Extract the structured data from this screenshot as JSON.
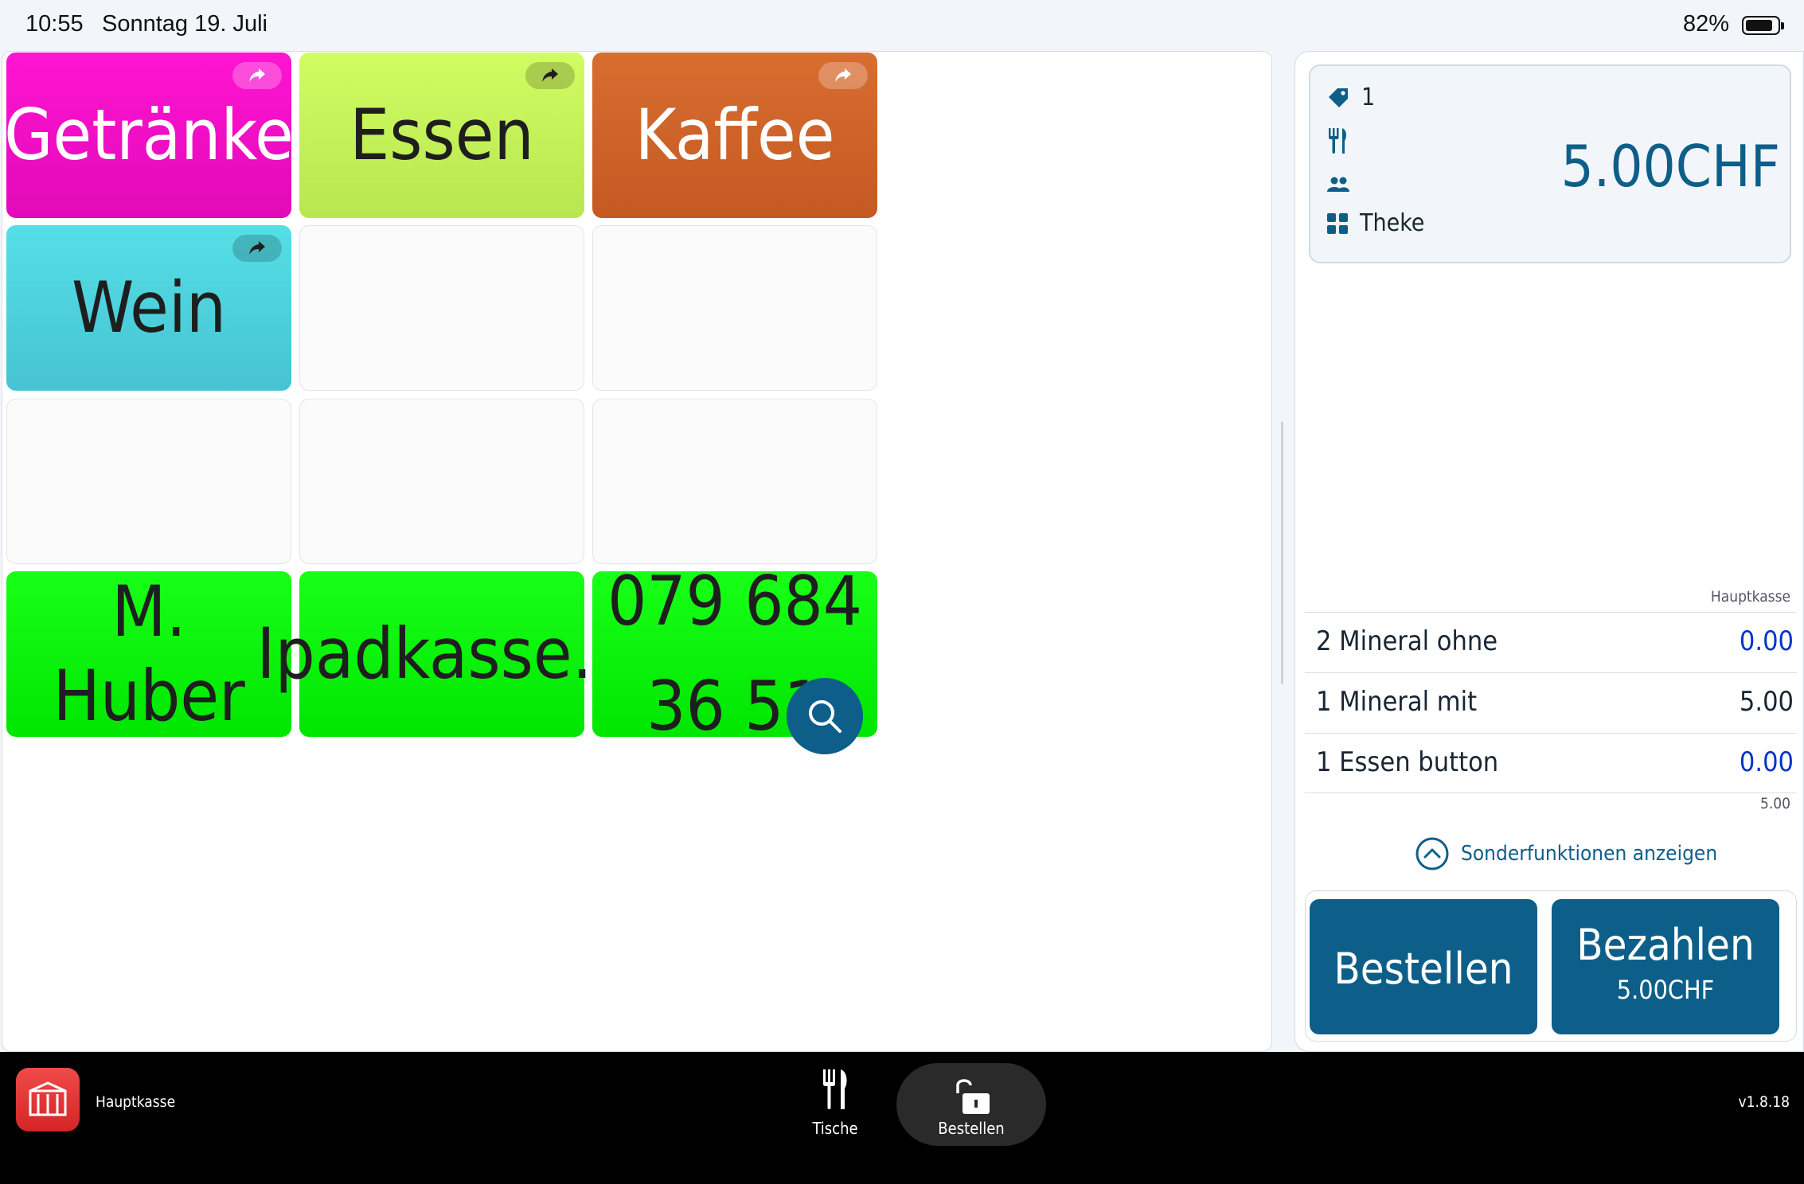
{
  "status_bar": {
    "time": "10:55",
    "date": "Sonntag 19. Juli",
    "battery_percent": "82%",
    "battery_level": 0.82
  },
  "grid": {
    "tiles": [
      {
        "label": "Getränke",
        "bg_top": "#ff14d2",
        "bg_bottom": "#e10ab8",
        "text_color": "#ffffff",
        "has_share": true
      },
      {
        "label": "Essen",
        "bg_top": "#d1fc62",
        "bg_bottom": "#b8e64f",
        "text_color": "#1e1e1e",
        "has_share": true
      },
      {
        "label": "Kaffee",
        "bg_top": "#d86d31",
        "bg_bottom": "#c45a22",
        "text_color": "#ffffff",
        "has_share": true
      },
      {
        "label": "Wein",
        "bg_top": "#55dfe6",
        "bg_bottom": "#46c3d2",
        "text_color": "#1e1e1e",
        "has_share": true
      },
      {
        "label": "",
        "empty": true
      },
      {
        "label": "",
        "empty": true
      },
      {
        "label": "",
        "empty": true
      },
      {
        "label": "",
        "empty": true
      },
      {
        "label": "",
        "empty": true
      },
      {
        "label": "M. Huber",
        "bg_top": "#18ff18",
        "bg_bottom": "#00e600",
        "text_color": "#1e1e1e",
        "has_share": false
      },
      {
        "label": "Ipadkasse.li",
        "bg_top": "#18ff18",
        "bg_bottom": "#00e600",
        "text_color": "#1e1e1e",
        "has_share": false
      },
      {
        "label": "079 684\n36 51",
        "bg_top": "#18ff18",
        "bg_bottom": "#00e600",
        "text_color": "#1e1e1e",
        "has_share": false,
        "two_line": true
      }
    ]
  },
  "order": {
    "order_number": "1",
    "total": "5.00CHF",
    "location": "Theke",
    "column_header": "Hauptkasse",
    "items": [
      {
        "name": "2 Mineral ohne",
        "price": "0.00",
        "price_color": "#0033cc"
      },
      {
        "name": "1 Mineral mit",
        "price": "5.00",
        "price_color": "#1a2533"
      },
      {
        "name": "1 Essen button",
        "price": "0.00",
        "price_color": "#0033cc"
      }
    ],
    "subtotal": "5.00",
    "special_functions": "Sonderfunktionen anzeigen",
    "order_button": "Bestellen",
    "pay_button": "Bezahlen",
    "pay_amount": "5.00CHF"
  },
  "bottom_bar": {
    "app_name": "Hauptkasse",
    "tabs": [
      {
        "label": "Tische",
        "icon": "fork-knife-icon"
      },
      {
        "label": "Bestellen",
        "icon": "unlock-icon"
      }
    ],
    "version": "v1.8.18"
  },
  "colors": {
    "accent": "#0d5f8a"
  }
}
